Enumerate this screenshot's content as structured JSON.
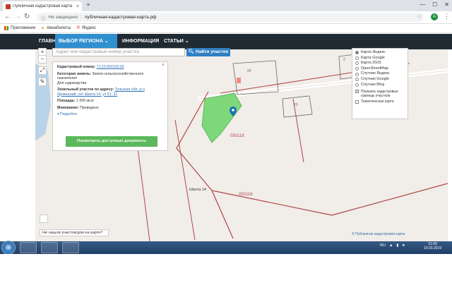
{
  "browser": {
    "tab_title": "Публичная кадастровая карта",
    "tab_close": "×",
    "new_tab": "+",
    "not_secure": "Не защищено",
    "url": "публичная-кадастровая-карта.рф",
    "avatar_letter": "A",
    "bookmarks": [
      "Приложения",
      "Авиабилеты",
      "Яндекс"
    ]
  },
  "site_nav": {
    "items": [
      "ГЛАВНАЯ",
      "ВЫБОР РЕГИОНА ⌄",
      "ИНФОРМАЦИЯ",
      "СТАТЬИ ⌄"
    ]
  },
  "search": {
    "placeholder": "Адрес или кадастровый номер участка",
    "button": "Найти участок"
  },
  "tools": {
    "zoom_in": "+",
    "zoom_out": "−"
  },
  "info_panel": {
    "cadastral_label": "Кадастровый номер:",
    "cadastral_value": "71:22:000120:29",
    "category_label": "Категория земель:",
    "category_value": "Земли сельскохозяйственного назначения",
    "usage_value": "Для садоводства",
    "address_label": "Земельный участок по адресу:",
    "address_value": "Тульская обл, р-н Щекинский, снт Шахта 14, уч 51, 31",
    "area_label": "Площадь:",
    "area_value": "1 000 кв.м",
    "survey_label": "Межевание:",
    "survey_value": "Проведено",
    "more": "▾ Подробно",
    "docs_button": "Посмотреть доступные документы",
    "close": "×"
  },
  "layers": {
    "options": [
      {
        "label": "Карта Яндекс",
        "selected": true
      },
      {
        "label": "Карта Google",
        "selected": false
      },
      {
        "label": "Карта 2GIS",
        "selected": false
      },
      {
        "label": "OpenStreetMap",
        "selected": false
      },
      {
        "label": "Спутник Яндекс",
        "selected": false
      },
      {
        "label": "Спутник Google",
        "selected": false
      },
      {
        "label": "Спутник Bing",
        "selected": false
      }
    ],
    "show_borders": "Показать кадастровые границы участков",
    "thematic": "Тематическая карта"
  },
  "map_labels": {
    "block1": "050118",
    "block2": "050118",
    "village": "Шахта 14",
    "lot24": "24",
    "lot23": "23",
    "lot21": "2"
  },
  "not_found": "Не нашли участок/дом на карте?",
  "attribution": "© Публичная кадастровая карта",
  "taskbar": {
    "lang": "RU",
    "time": "21:09",
    "date": "19.03.2019"
  },
  "colors": {
    "header": "#1f2a33",
    "accent": "#2f8fcf",
    "parcel_green": "#7ed87a",
    "boundary": "#b0474a",
    "docs_btn": "#5cb85c"
  }
}
